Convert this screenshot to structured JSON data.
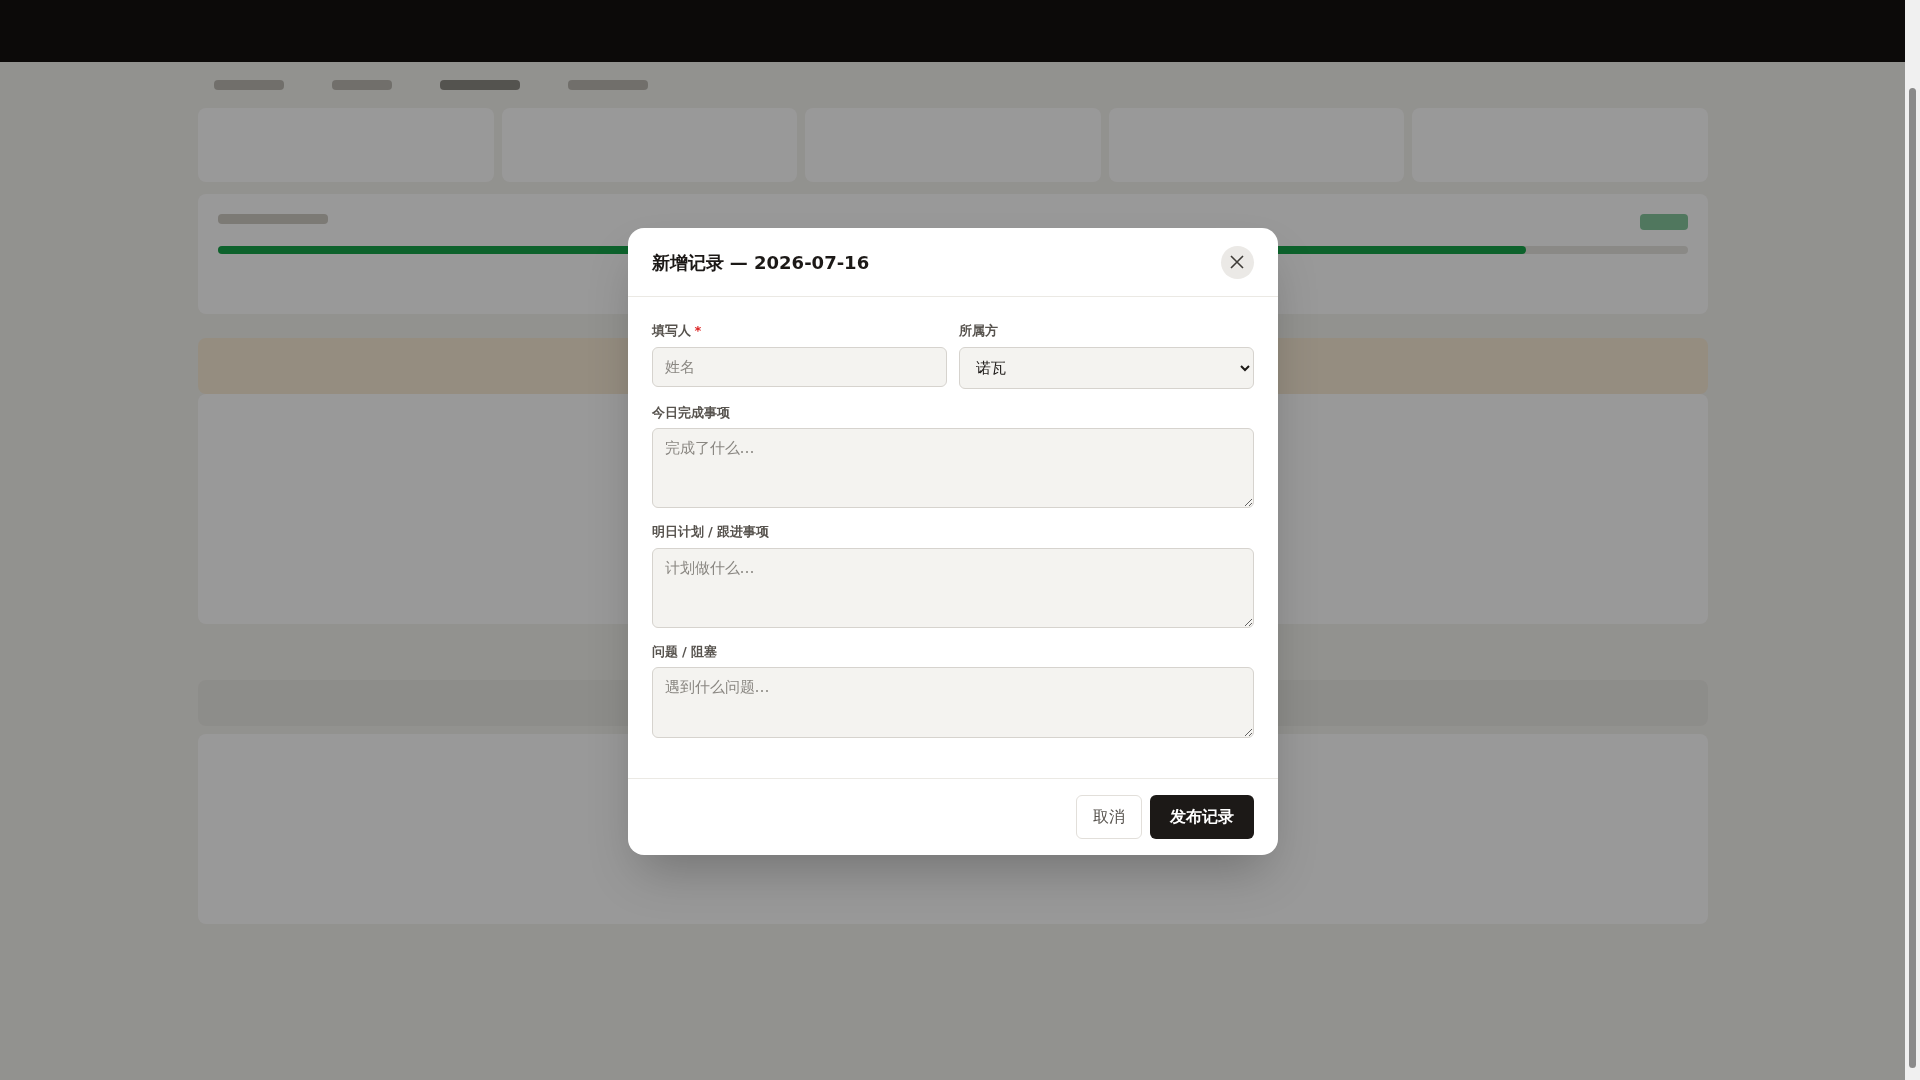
{
  "background": {
    "progress": {
      "level": 0.89
    }
  },
  "dialog": {
    "title": "新增记录 — 2026-07-16",
    "fields": [
      {
        "kind": "input",
        "label": "填写人",
        "marker": "*",
        "placeholder": "姓名"
      },
      {
        "kind": "select",
        "label": "所属方",
        "value": "诺瓦"
      },
      {
        "kind": "textarea",
        "label": "今日完成事项",
        "placeholder": "完成了什么…"
      },
      {
        "kind": "textarea",
        "label": "明日计划 / 跟进事项",
        "placeholder": "计划做什么…"
      },
      {
        "kind": "textarea",
        "label": "问题 / 阻塞",
        "placeholder": "遇到什么问题…"
      }
    ],
    "buttons": [
      {
        "label": "取消",
        "kind": "secondary"
      },
      {
        "label": "发布记录",
        "kind": "primary"
      }
    ]
  }
}
